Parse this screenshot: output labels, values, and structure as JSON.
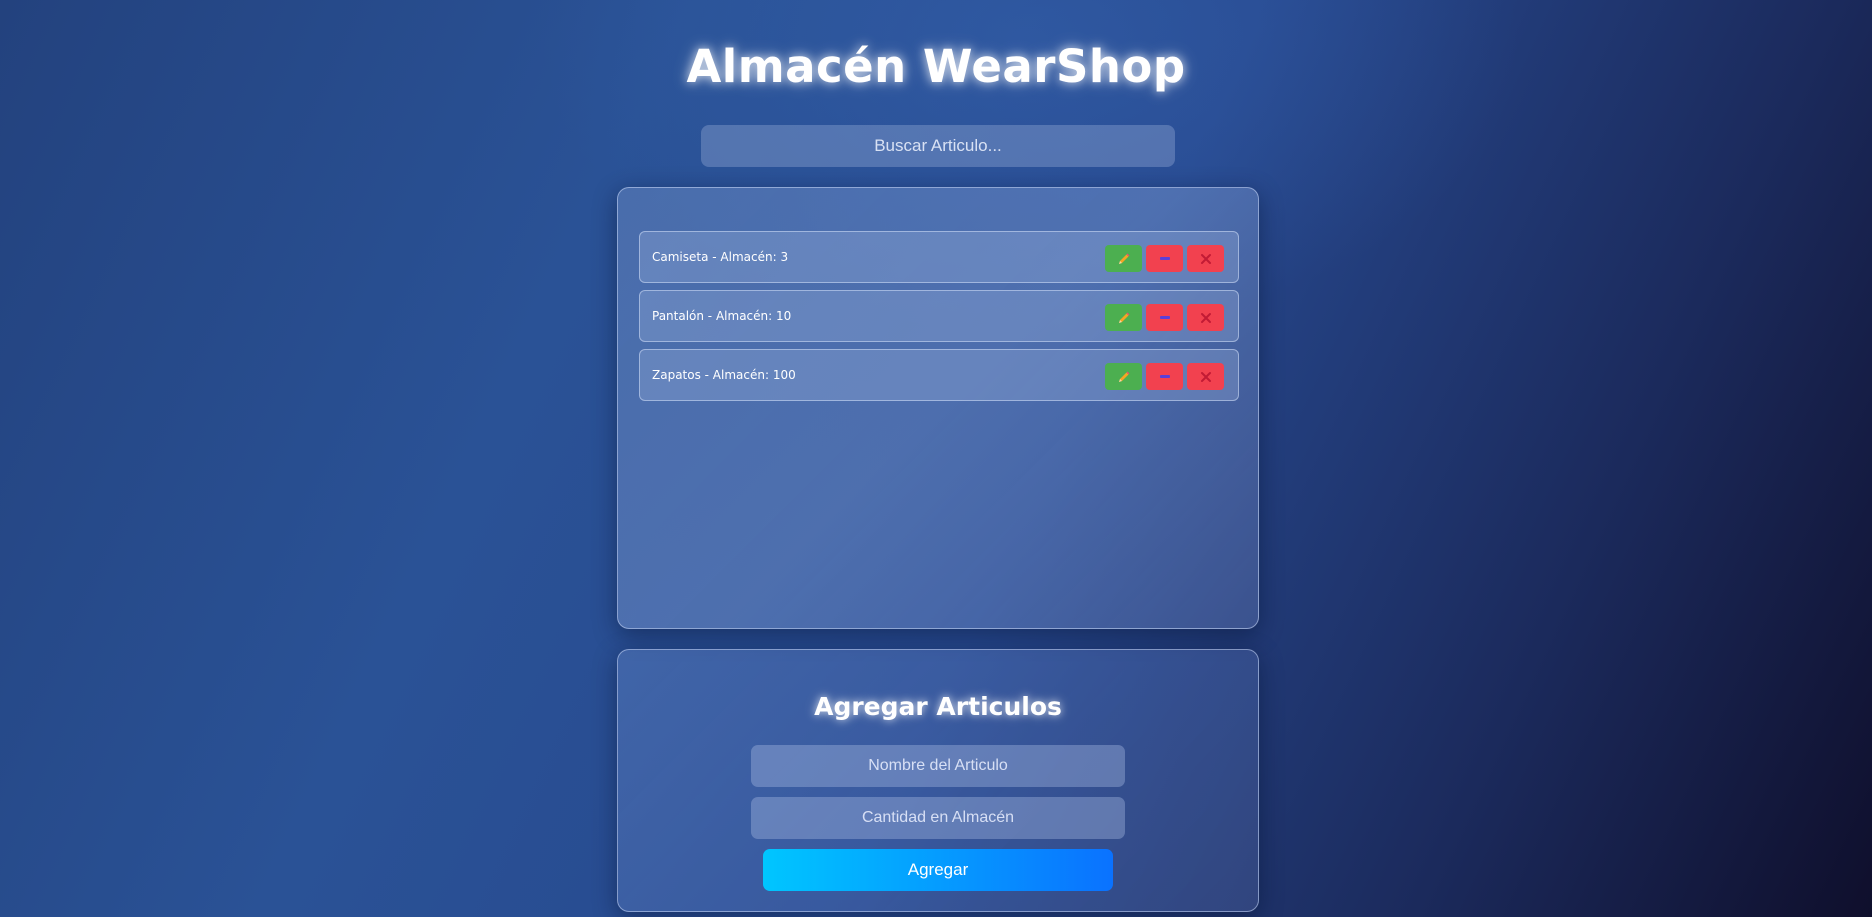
{
  "header": {
    "title": "Almacén WearShop"
  },
  "search": {
    "placeholder": "Buscar Articulo..."
  },
  "inventory": {
    "items": [
      {
        "label": "Camiseta - Almacén: 3"
      },
      {
        "label": "Pantalón - Almacén: 10"
      },
      {
        "label": "Zapatos - Almacén: 100"
      }
    ],
    "actions": [
      "pencil-icon",
      "minus-icon",
      "close-icon"
    ]
  },
  "form": {
    "title": "Agregar Articulos",
    "name_placeholder": "Nombre del Articulo",
    "quantity_placeholder": "Cantidad en Almacén",
    "submit_label": "Agregar"
  },
  "colors": {
    "edit": "#4caf50",
    "danger": "#f2414f",
    "submit_start": "#00c6ff",
    "submit_end": "#0a72ff"
  }
}
